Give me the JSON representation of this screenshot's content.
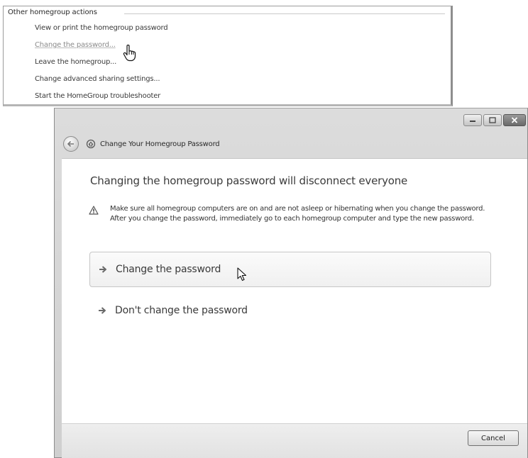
{
  "homegroup_actions": {
    "title": "Other homegroup actions",
    "links": [
      "View or print the homegroup password",
      "Change the password...",
      "Leave the homegroup...",
      "Change advanced sharing settings...",
      "Start the HomeGroup troubleshooter"
    ]
  },
  "dialog": {
    "title": "Change Your Homegroup Password",
    "heading": "Changing the homegroup password will disconnect everyone",
    "warning": "Make sure all homegroup computers are on and are not asleep or hibernating when you change the password. After you change the password, immediately go to each homegroup computer and type the new password.",
    "options": [
      {
        "label": "Change the password",
        "icon": "arrow-right-icon"
      },
      {
        "label": "Don't change the password",
        "icon": "arrow-right-icon"
      }
    ],
    "cancel_label": "Cancel"
  },
  "colors": {
    "panel_border": "#9c9c9c",
    "window_frame": "#d5d5d5",
    "content_bg": "#ffffff",
    "option_hover_bg": "#f4f4f4"
  }
}
